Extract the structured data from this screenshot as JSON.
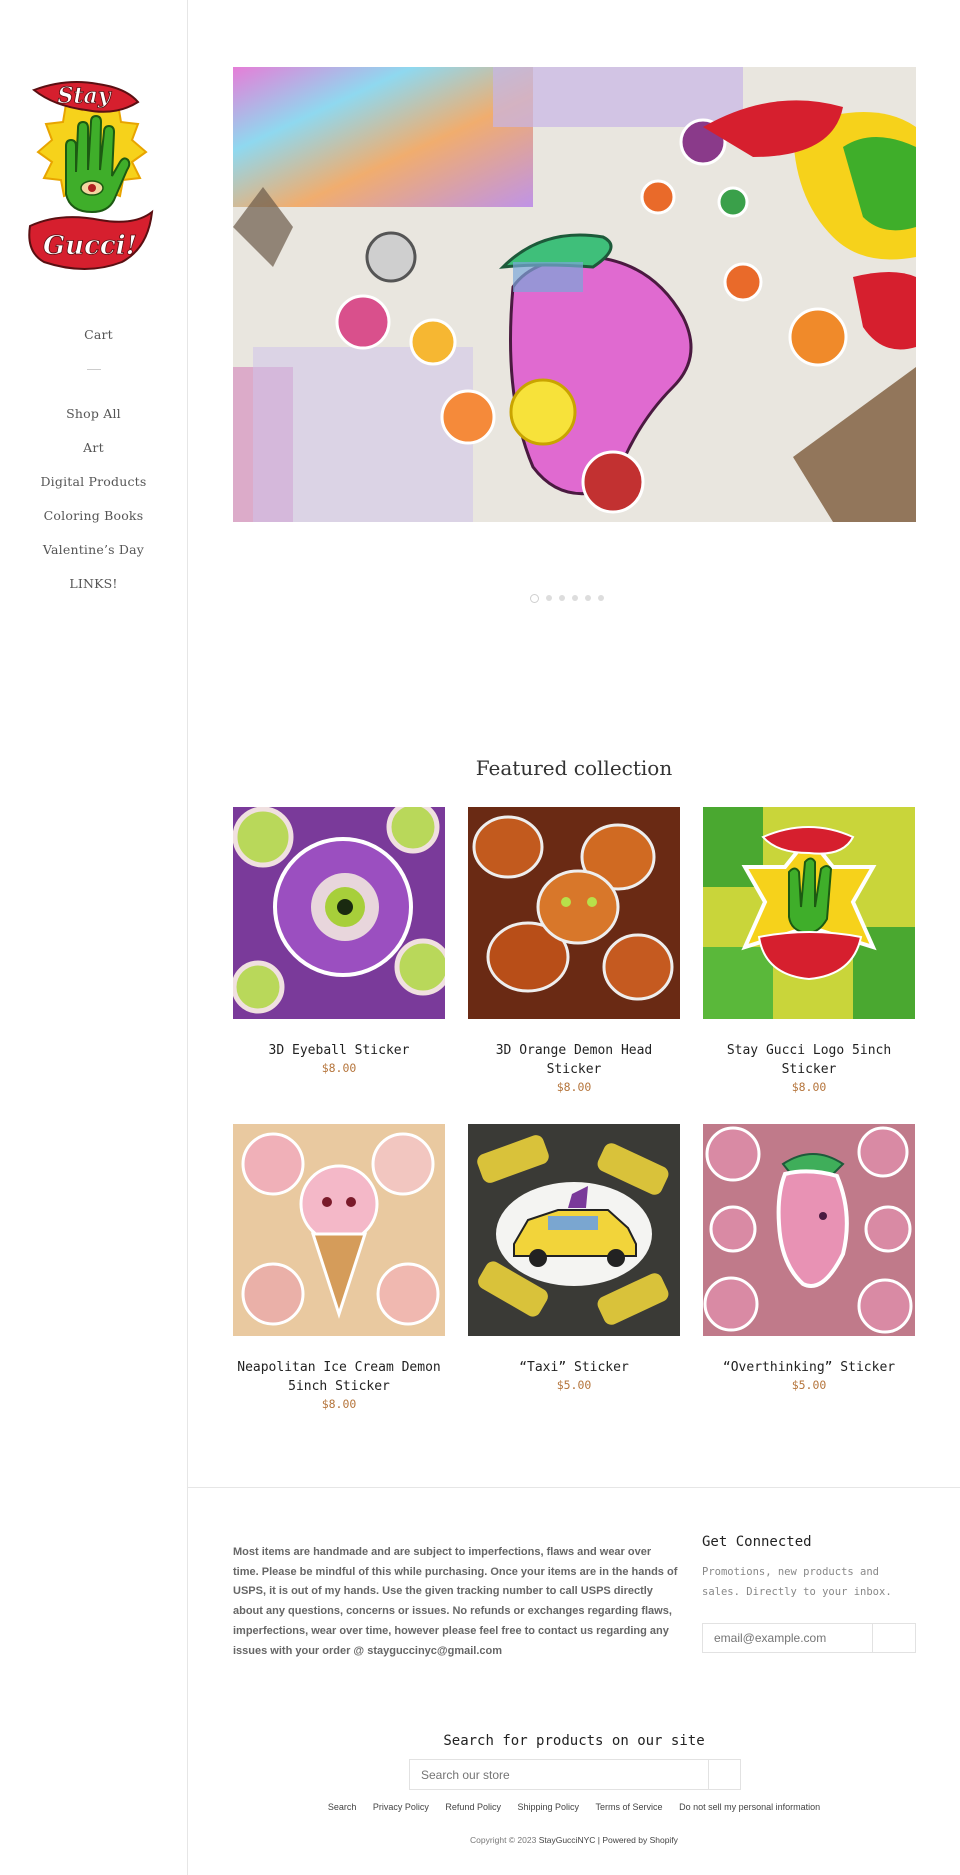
{
  "sidebar": {
    "logo_top_text": "Stay",
    "logo_bottom_text": "Gucci!",
    "cart_label": "Cart",
    "nav": [
      "Shop All",
      "Art",
      "Digital Products",
      "Coloring Books",
      "Valentine’s Day",
      "LINKS!"
    ]
  },
  "slideshow": {
    "slide_count": 6,
    "active_index": 0
  },
  "featured": {
    "title": "Featured collection",
    "products": [
      {
        "name": "3D Eyeball Sticker",
        "price": "$8.00"
      },
      {
        "name": "3D Orange Demon Head Sticker",
        "price": "$8.00"
      },
      {
        "name": "Stay Gucci Logo 5inch Sticker",
        "price": "$8.00"
      },
      {
        "name": "Neapolitan Ice Cream Demon 5inch Sticker",
        "price": "$8.00"
      },
      {
        "name": "“Taxi” Sticker",
        "price": "$5.00"
      },
      {
        "name": "“Overthinking” Sticker",
        "price": "$5.00"
      }
    ]
  },
  "footer": {
    "notice": "Most items are handmade and are subject to imperfections, flaws and wear over time. Please be mindful of this while purchasing. Once your items are in the hands of USPS, it is out of my hands. Use the given tracking number to call USPS directly about any questions, concerns or issues. No refunds or exchanges regarding flaws, imperfections, wear over time, however please feel free to contact us regarding any issues with your order @ stayguccinyc@gmail.com",
    "connect_title": "Get Connected",
    "connect_subtitle": "Promotions, new products and sales. Directly to your inbox.",
    "email_placeholder": "email@example.com",
    "search_title": "Search for products on our site",
    "search_placeholder": "Search our store",
    "links": [
      "Search",
      "Privacy Policy",
      "Refund Policy",
      "Shipping Policy",
      "Terms of Service",
      "Do not sell my personal information"
    ],
    "copyright_prefix": "Copyright © 2023",
    "shop_name": "StayGucciNYC",
    "powered_by": "| Powered by Shopify"
  },
  "colors": {
    "price": "#b5753c",
    "border": "#e6e6e6"
  }
}
